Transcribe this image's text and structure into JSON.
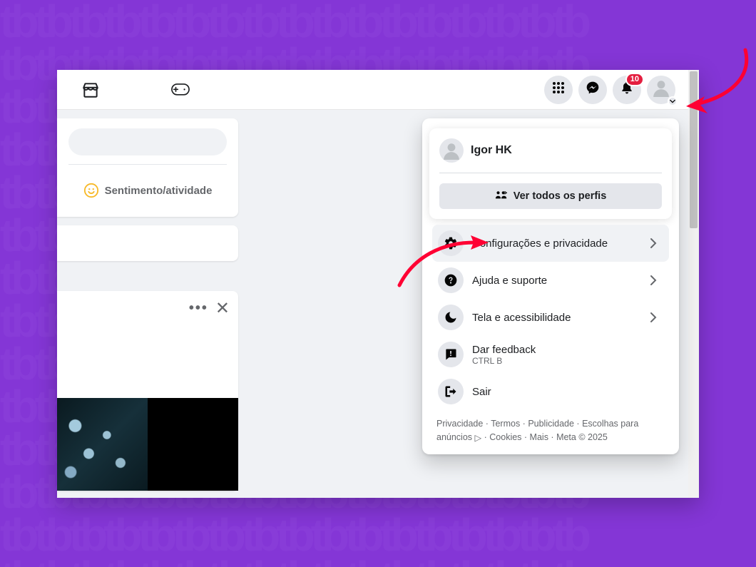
{
  "topbar": {
    "notification_badge": "10"
  },
  "composer": {
    "feeling_label": "Sentimento/atividade"
  },
  "dropdown": {
    "profile_name": "Igor HK",
    "see_all_profiles": "Ver todos os perfis",
    "items": [
      {
        "label": "Configurações e privacidade",
        "has_arrow": true
      },
      {
        "label": "Ajuda e suporte",
        "has_arrow": true
      },
      {
        "label": "Tela e acessibilidade",
        "has_arrow": true
      },
      {
        "label": "Dar feedback",
        "sub": "CTRL B",
        "has_arrow": false
      },
      {
        "label": "Sair",
        "has_arrow": false
      }
    ],
    "footer": {
      "privacidade": "Privacidade",
      "termos": "Termos",
      "publicidade": "Publicidade",
      "escolhas": "Escolhas para anúncios",
      "cookies": "Cookies",
      "mais": "Mais",
      "meta": "Meta © 2025"
    }
  }
}
